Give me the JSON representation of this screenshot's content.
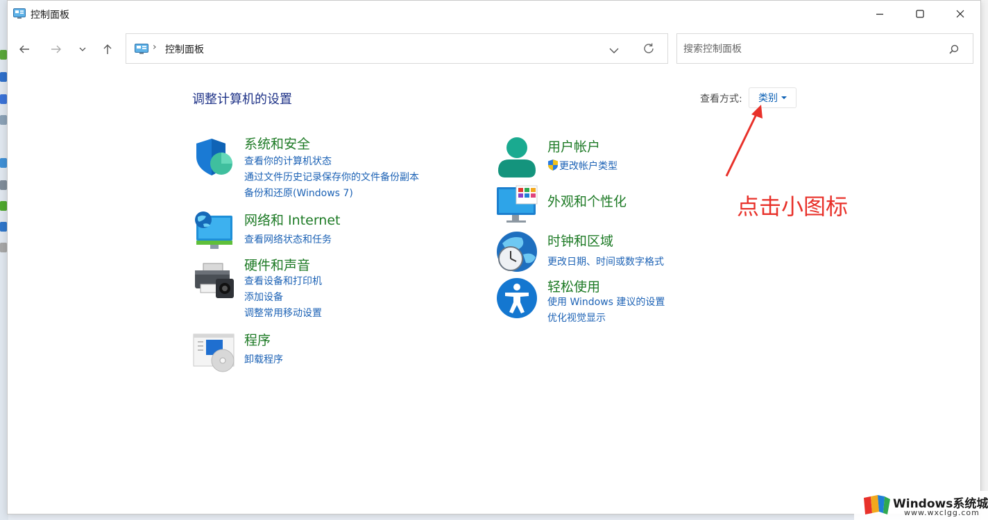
{
  "window": {
    "title": "控制面板"
  },
  "address_bar": {
    "crumb": "控制面板"
  },
  "search": {
    "placeholder": "搜索控制面板"
  },
  "main": {
    "title": "调整计算机的设置",
    "view_by_label": "查看方式:",
    "view_by_value": "类别"
  },
  "categories": [
    {
      "title": "系统和安全",
      "icon": "shield-icon",
      "links": [
        "查看你的计算机状态",
        "通过文件历史记录保存你的文件备份副本",
        "备份和还原(Windows 7)"
      ]
    },
    {
      "title": "网络和 Internet",
      "icon": "network-globe-icon",
      "links": [
        "查看网络状态和任务"
      ]
    },
    {
      "title": "硬件和声音",
      "icon": "printer-icon",
      "links": [
        "查看设备和打印机",
        "添加设备",
        "调整常用移动设置"
      ]
    },
    {
      "title": "程序",
      "icon": "programs-disc-icon",
      "links": [
        "卸载程序"
      ]
    },
    {
      "title": "用户帐户",
      "icon": "user-account-icon",
      "links": [
        "更改帐户类型"
      ]
    },
    {
      "title": "外观和个性化",
      "icon": "monitor-personalize-icon",
      "links": []
    },
    {
      "title": "时钟和区域",
      "icon": "clock-globe-icon",
      "links": [
        "更改日期、时间或数字格式"
      ]
    },
    {
      "title": "轻松使用",
      "icon": "accessibility-icon",
      "links": [
        "使用 Windows 建议的设置",
        "优化视觉显示"
      ]
    }
  ],
  "annotation": {
    "text": "点击小图标",
    "color": "#e8312a"
  },
  "watermark": {
    "brand": "Windows系统城",
    "url": "www.wxclgg.com"
  },
  "colors": {
    "category_title": "#1d7a25",
    "link": "#1c62b5",
    "page_title": "#1e3287"
  }
}
